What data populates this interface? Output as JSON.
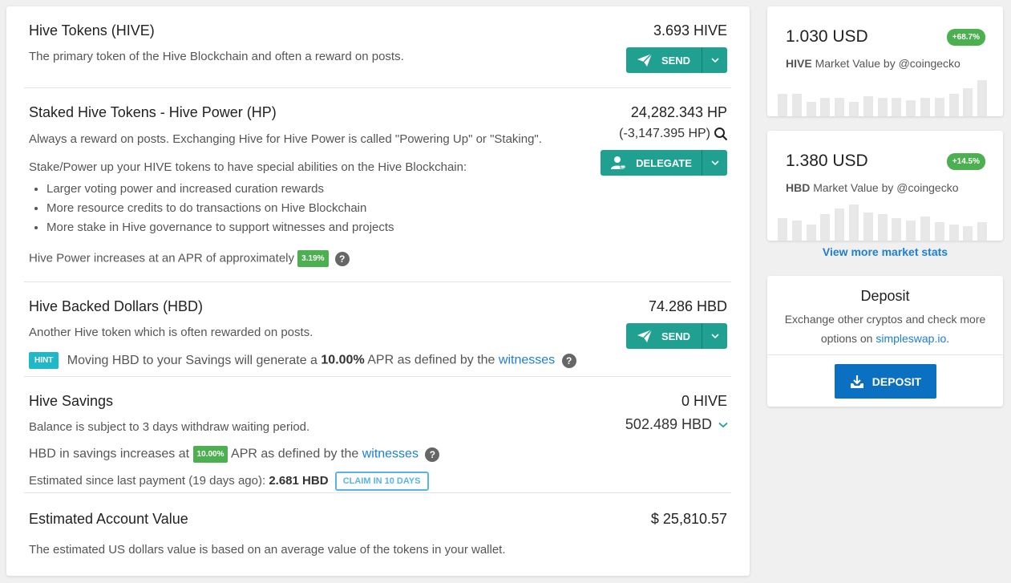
{
  "hive": {
    "title": "Hive Tokens (HIVE)",
    "desc": "The primary token of the Hive Blockchain and often a reward on posts.",
    "amount": "3.693 HIVE",
    "send_label": "SEND"
  },
  "hp": {
    "title": "Staked Hive Tokens - Hive Power (HP)",
    "desc": "Always a reward on posts. Exchanging Hive for Hive Power is called \"Powering Up\" or \"Staking\".",
    "amount": "24,282.343 HP",
    "delegated": "(-3,147.395 HP)",
    "delegate_label": "DELEGATE",
    "stake_desc": "Stake/Power up your HIVE tokens to have special abilities on the Hive Blockchain:",
    "bullets": [
      "Larger voting power and increased curation rewards",
      "More resource credits to do transactions on Hive Blockchain",
      "More stake in Hive governance to support witnesses and projects"
    ],
    "apr_text": "Hive Power increases at an APR of approximately",
    "apr_value": "3.19%"
  },
  "hbd": {
    "title": "Hive Backed Dollars (HBD)",
    "desc": "Another Hive token which is often rewarded on posts.",
    "amount": "74.286 HBD",
    "send_label": "SEND",
    "hint_badge": "HINT",
    "hint_pre": "Moving HBD to your Savings will generate a",
    "hint_apr": "10.00%",
    "hint_post": "APR as defined by the",
    "hint_link": "witnesses"
  },
  "savings": {
    "title": "Hive Savings",
    "desc": "Balance is subject to 3 days withdraw waiting period.",
    "amount_hive": "0 HIVE",
    "amount_hbd": "502.489 HBD",
    "apr_pre": "HBD in savings increases at",
    "apr_value": "10.00%",
    "apr_post": "APR as defined by the",
    "apr_link": "witnesses",
    "estimate_pre": "Estimated since last payment (19 days ago):",
    "estimate_value": "2.681 HBD",
    "claim_label": "CLAIM IN 10 DAYS"
  },
  "account": {
    "title": "Estimated Account Value",
    "desc": "The estimated US dollars value is based on an average value of the tokens in your wallet.",
    "amount": "$ 25,810.57"
  },
  "market": [
    {
      "price": "1.030 USD",
      "change": "+68.7%",
      "token": "HIVE",
      "label": "Market Value by @coingecko",
      "bars": [
        0.55,
        0.55,
        0.35,
        0.45,
        0.45,
        0.35,
        0.5,
        0.45,
        0.45,
        0.4,
        0.45,
        0.45,
        0.55,
        0.7,
        0.9
      ]
    },
    {
      "price": "1.380 USD",
      "change": "+14.5%",
      "token": "HBD",
      "label": "Market Value by @coingecko",
      "bars": [
        0.55,
        0.5,
        0.4,
        0.65,
        0.8,
        0.9,
        0.7,
        0.65,
        0.55,
        0.5,
        0.6,
        0.45,
        0.4,
        0.35,
        0.45
      ]
    }
  ],
  "market_link": "View more market stats",
  "deposit": {
    "title": "Deposit",
    "desc_line1": "Exchange other cryptos and check more",
    "desc_pre": "options on",
    "desc_link": "simpleswap.io",
    "desc_post": ".",
    "button_label": "DEPOSIT"
  },
  "colors": {
    "teal": "#1fa091",
    "green_badge": "#4caf50",
    "hint": "#1fb8c9",
    "link": "#1c7ed6",
    "deposit_btn": "#0b6fc2"
  }
}
